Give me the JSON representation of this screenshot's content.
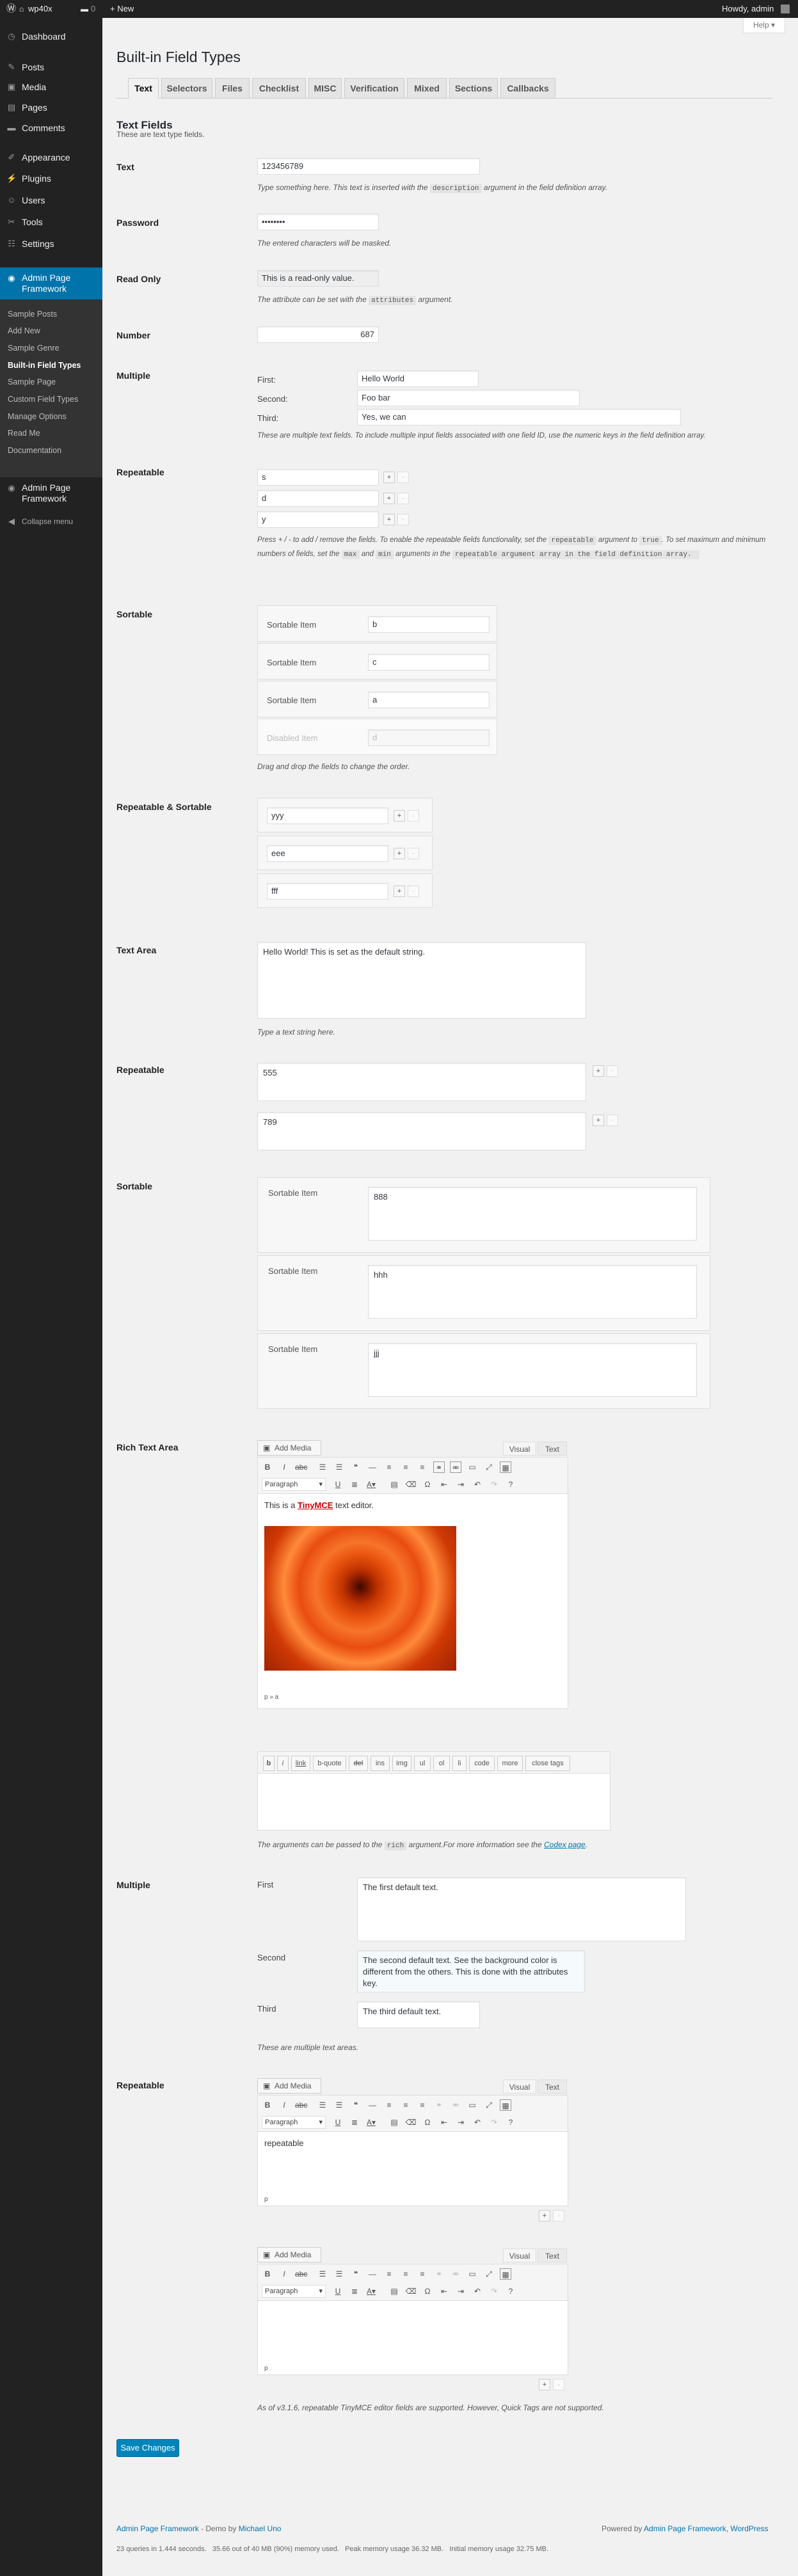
{
  "adminbar": {
    "site": "wp40x",
    "new_label": "+ New",
    "howdy": "Howdy, admin"
  },
  "menu": {
    "items": [
      {
        "label": "Dashboard",
        "icon": "dashboard-icon"
      },
      {
        "label": "Posts",
        "icon": "pin-icon"
      },
      {
        "label": "Media",
        "icon": "media-icon"
      },
      {
        "label": "Pages",
        "icon": "page-icon"
      },
      {
        "label": "Comments",
        "icon": "comment-icon"
      },
      {
        "label": "Appearance",
        "icon": "brush-icon"
      },
      {
        "label": "Plugins",
        "icon": "plugin-icon"
      },
      {
        "label": "Users",
        "icon": "user-icon"
      },
      {
        "label": "Tools",
        "icon": "wrench-icon"
      },
      {
        "label": "Settings",
        "icon": "settings-icon"
      },
      {
        "label": "Admin Page Framework",
        "icon": "framework-icon"
      },
      {
        "label": "Admin Page Framework",
        "icon": "framework-icon"
      }
    ],
    "collapse": "Collapse menu",
    "sub": [
      "Sample Posts",
      "Add New",
      "Sample Genre",
      "Built-in Field Types",
      "Sample Page",
      "Custom Field Types",
      "Manage Options",
      "Read Me",
      "Documentation"
    ]
  },
  "help": "Help ▾",
  "title": "Built-in Field Types",
  "tabs": [
    "Text",
    "Selectors",
    "Files",
    "Checklist",
    "MISC",
    "Verification",
    "Mixed",
    "Sections",
    "Callbacks"
  ],
  "section": {
    "title": "Text Fields",
    "desc": "These are text type fields."
  },
  "text": {
    "label": "Text",
    "value": "123456789",
    "desc_a": "Type something here. This text is inserted with the",
    "desc_code": "description",
    "desc_b": "argument in the field definition array."
  },
  "password": {
    "label": "Password",
    "value": "••••••••",
    "desc": "The entered characters will be masked."
  },
  "readonly": {
    "label": "Read Only",
    "value": "This is a read-only value.",
    "desc_a": "The attribute can be set with the",
    "desc_code": "attributes",
    "desc_b": "argument."
  },
  "number": {
    "label": "Number",
    "value": "687"
  },
  "multiple": {
    "label": "Multiple",
    "items": [
      {
        "label": "First:",
        "value": "Hello World"
      },
      {
        "label": "Second:",
        "value": "Foo bar"
      },
      {
        "label": "Third:",
        "value": "Yes, we can"
      }
    ],
    "desc": "These are multiple text fields. To include multiple input fields associated with one field ID, use the numeric keys in the field definition array."
  },
  "repeatable": {
    "label": "Repeatable",
    "values": [
      "s",
      "d",
      "y"
    ],
    "plus": "+",
    "minus": "-",
    "desc_1": "Press + / - to add / remove the fields. To enable the repeatable fields functionality, set the",
    "c1": "repeatable",
    "desc_2": "argument to",
    "c2": "true",
    "desc_3": ". To set maximum and minimum numbers of fields, set the",
    "c3": "max",
    "desc_4": "and",
    "c4": "min",
    "desc_5": "arguments in the",
    "c5": "repeatable argument array in the field definition array.",
    "c6": ""
  },
  "sortable": {
    "label": "Sortable",
    "items": [
      {
        "label": "Sortable Item",
        "value": "b"
      },
      {
        "label": "Sortable Item",
        "value": "c"
      },
      {
        "label": "Sortable Item",
        "value": "a"
      },
      {
        "label": "Disabled Item",
        "value": "d"
      }
    ],
    "desc": "Drag and drop the fields to change the order."
  },
  "repsort": {
    "label": "Repeatable & Sortable",
    "values": [
      "yyy",
      "eee",
      "fff"
    ]
  },
  "textarea": {
    "label": "Text Area",
    "value": "Hello World! This is set as the default string.",
    "desc": "Type a text string here."
  },
  "reptextarea": {
    "label": "Repeatable",
    "values": [
      "555",
      "789"
    ]
  },
  "sorttextarea": {
    "label": "Sortable",
    "items": [
      {
        "label": "Sortable Item",
        "value": "888"
      },
      {
        "label": "Sortable Item",
        "value": "hhh"
      },
      {
        "label": "Sortable Item",
        "value": "jjj"
      }
    ]
  },
  "richtext": {
    "label": "Rich Text Area",
    "add_media": "Add Media",
    "visual": "Visual",
    "text": "Text",
    "format": "Paragraph",
    "content_a": "This is a",
    "content_b": "TinyMCE",
    "content_c": "text editor.",
    "path": "p » a",
    "quicktags": [
      "b",
      "i",
      "link",
      "b-quote",
      "del",
      "ins",
      "img",
      "ul",
      "ol",
      "li",
      "code",
      "more",
      "close tags"
    ],
    "desc_a": "The arguments can be passed to the",
    "desc_code": "rich",
    "desc_b": "argument.For more information see the",
    "desc_link": "Codex page",
    "desc_c": "."
  },
  "multiple_ta": {
    "label": "Multiple",
    "items": [
      {
        "label": "First",
        "value": "The first default text."
      },
      {
        "label": "Second",
        "value": "The second default text. See the background color is different from the others. This is done with the attributes key."
      },
      {
        "label": "Third",
        "value": "The third default text."
      }
    ],
    "desc": "These are multiple text areas."
  },
  "repeditor": {
    "label": "Repeatable",
    "content": "repeatable",
    "path": "p",
    "desc": "As of v3.1.6, repeatable TinyMCE editor fields are supported. However, Quick Tags are not supported."
  },
  "save": "Save Changes",
  "footer": {
    "left_a": "Admin Page Framework",
    "left_b": "- Demo by",
    "left_c": "Michael Uno",
    "right_a": "Powered by",
    "right_b": "Admin Page Framework",
    "right_c": ", WordPress",
    "stats": "23 queries in 1.444 seconds.   35.66 out of 40 MB (90%) memory used.   Peak memory usage 36.32 MB.   Initial memory usage 32.75 MB."
  }
}
